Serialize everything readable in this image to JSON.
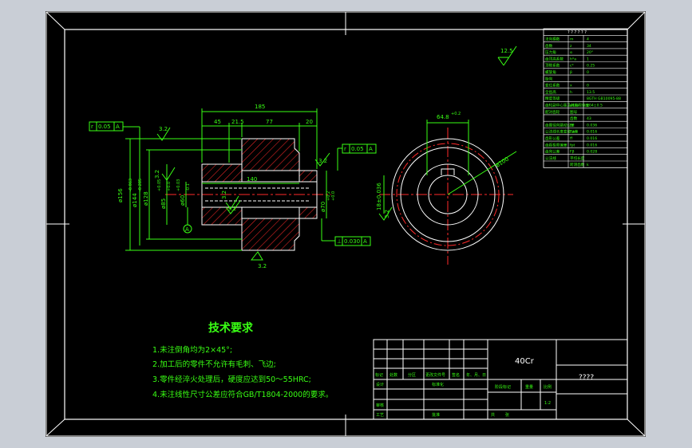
{
  "colors": {
    "background": "#c9ced6",
    "canvas": "#000000",
    "frame": "#ffffff",
    "part": "#ffffff",
    "dimension": "#39ff14",
    "centerline": "#ff2a2a",
    "hatch": "#ff2a2a",
    "table_text": "#39ff14",
    "title_text": "#ffffff",
    "section_circle": "#ffffff"
  },
  "gear_table": {
    "header": "? ? ? ? ? ?",
    "rows": [
      {
        "name": "法向模数",
        "symbol": "m",
        "value": "4"
      },
      {
        "name": "齿数",
        "symbol": "z",
        "value": "34"
      },
      {
        "name": "压力角",
        "symbol": "α",
        "value": "20°"
      },
      {
        "name": "齿顶高系数",
        "symbol": "h*a",
        "value": "1"
      },
      {
        "name": "顶隙系数",
        "symbol": "c*",
        "value": "0.25"
      },
      {
        "name": "螺旋角",
        "symbol": "β",
        "value": "0"
      },
      {
        "name": "旋向",
        "symbol": "",
        "value": ""
      },
      {
        "name": "变位系数",
        "symbol": "x",
        "value": "0"
      },
      {
        "name": "全齿高",
        "symbol": "h",
        "value": "13.5"
      },
      {
        "name": "精度等级",
        "symbol": "",
        "value": "8GTH GB10095-88"
      },
      {
        "name": "齿轮副中心距及其极限偏差",
        "symbol": "a±fa",
        "value": "204±0.5"
      },
      {
        "name": "配对齿轮",
        "symbol": "图号",
        "value": ""
      },
      {
        "name": "",
        "symbol": "齿数",
        "value": "43"
      },
      {
        "name": "齿圈径向跳动公差",
        "symbol": "Fr",
        "value": "0.036"
      },
      {
        "name": "公法线长度变动公差",
        "symbol": "Fw",
        "value": "0.016"
      },
      {
        "name": "齿形公差",
        "symbol": "ff",
        "value": "0.016"
      },
      {
        "name": "齿距极限偏差",
        "symbol": "fpt",
        "value": "0.016"
      },
      {
        "name": "齿向公差",
        "symbol": "Fβ",
        "value": "0.028"
      },
      {
        "name": "公法线",
        "symbol": "平均长度",
        "value": ""
      },
      {
        "name": "",
        "symbol": "跨测齿数",
        "value": "k"
      }
    ]
  },
  "roughness_top_right": "12.5",
  "front_view": {
    "dims": {
      "overall_length": "185",
      "d45": "45",
      "d21_5": "21.5",
      "d77": "77",
      "d20": "20",
      "d140": "140",
      "dia156": "ø156",
      "dia144": "ø144",
      "dia144_tol_up": "-0.063",
      "dia144_tol_low": "-0.285",
      "dia128": "ø128",
      "dia85": "ø85",
      "dia85_tol_up": "+0.05",
      "dia85_tol_low": "+0.0",
      "dia60": "ø60",
      "dia60_tol_up": "+0.03",
      "dia60_tol_low": "-0.1",
      "dia70": "ø70",
      "dia70_tol_up": "+0.2",
      "dia70_tol_low": "+0.0",
      "rough_a": "3.2",
      "rough_b": "3.2",
      "rough_c": "3.2",
      "rough_d": "3.2",
      "rough_e": "3.2",
      "rough_f": "3.2"
    },
    "tol_left": {
      "sym": "r",
      "value": "0.05",
      "datum": "A"
    },
    "tol_right": {
      "sym": "r",
      "value": "0.05",
      "datum": "A"
    },
    "tol_bottom": {
      "sym": "⊥",
      "value": "0.030",
      "datum": "A"
    },
    "datum_label": "A"
  },
  "side_view": {
    "key_width": "64.8",
    "key_tol": "+0.2",
    "dia_keyway": "18±0.036",
    "dia_outer": "ø100",
    "rough": "3.2"
  },
  "tech_requirements": {
    "title": "技术要求",
    "items": [
      "1.未注倒角均为2×45°;",
      "2.加工后的零件不允许有毛刺、飞边;",
      "3.零件经淬火处理后，硬度应达到50～55HRC;",
      "4.未注线性尺寸公差应符合GB/T1804-2000的要求。"
    ]
  },
  "title_block": {
    "material": "40Cr",
    "drawing_name": "????",
    "labels": {
      "mark": "标记",
      "count": "处数",
      "zone": "分区",
      "change_doc": "更改文件号",
      "sign": "签名",
      "date": "年、月、日",
      "design": "设计",
      "standardize": "标准化",
      "stage_mark": "阶段标记",
      "weight": "重量",
      "scale": "比例",
      "review": "审核",
      "process": "工艺",
      "approve": "批准",
      "total": "共",
      "sheet": "张",
      "ratio": "1:2"
    }
  }
}
